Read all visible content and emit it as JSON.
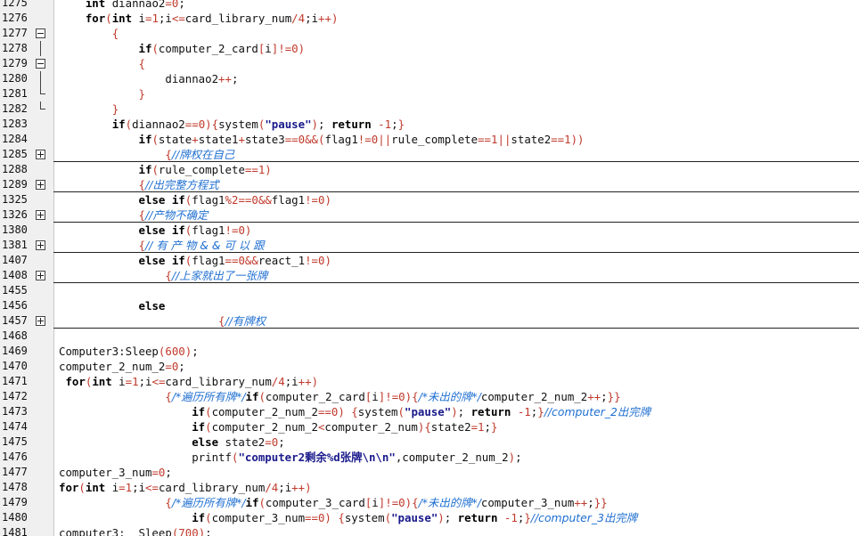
{
  "lines": [
    {
      "n": "1275",
      "fold": "none",
      "sep": false,
      "tokens": [
        [
          "pl",
          "    "
        ],
        [
          "kw",
          "int"
        ],
        [
          "pl",
          " diannao2"
        ],
        [
          "op",
          "="
        ],
        [
          "num",
          "0"
        ],
        [
          "pl",
          ";"
        ]
      ]
    },
    {
      "n": "1276",
      "fold": "none",
      "sep": false,
      "tokens": [
        [
          "pl",
          "    "
        ],
        [
          "kw",
          "for"
        ],
        [
          "br",
          "("
        ],
        [
          "kw",
          "int"
        ],
        [
          "pl",
          " i"
        ],
        [
          "op",
          "="
        ],
        [
          "num",
          "1"
        ],
        [
          "pl",
          ";i"
        ],
        [
          "op",
          "<="
        ],
        [
          "pl",
          "card_library_num"
        ],
        [
          "op",
          "/"
        ],
        [
          "num",
          "4"
        ],
        [
          "pl",
          ";i"
        ],
        [
          "op",
          "++"
        ],
        [
          "br",
          ")"
        ]
      ]
    },
    {
      "n": "1277",
      "fold": "minus",
      "sep": false,
      "tokens": [
        [
          "pl",
          "        "
        ],
        [
          "br",
          "{"
        ]
      ]
    },
    {
      "n": "1278",
      "fold": "line",
      "sep": false,
      "tokens": [
        [
          "pl",
          "            "
        ],
        [
          "kw",
          "if"
        ],
        [
          "br",
          "("
        ],
        [
          "pl",
          "computer_2_card"
        ],
        [
          "br",
          "["
        ],
        [
          "pl",
          "i"
        ],
        [
          "br",
          "]"
        ],
        [
          "op",
          "!="
        ],
        [
          "num",
          "0"
        ],
        [
          "br",
          ")"
        ]
      ]
    },
    {
      "n": "1279",
      "fold": "minus",
      "sep": false,
      "tokens": [
        [
          "pl",
          "            "
        ],
        [
          "br",
          "{"
        ]
      ]
    },
    {
      "n": "1280",
      "fold": "line",
      "sep": false,
      "tokens": [
        [
          "pl",
          "                diannao2"
        ],
        [
          "op",
          "++"
        ],
        [
          "pl",
          ";"
        ]
      ]
    },
    {
      "n": "1281",
      "fold": "end",
      "sep": false,
      "tokens": [
        [
          "pl",
          "            "
        ],
        [
          "br",
          "}"
        ]
      ]
    },
    {
      "n": "1282",
      "fold": "end",
      "sep": false,
      "tokens": [
        [
          "pl",
          "        "
        ],
        [
          "br",
          "}"
        ]
      ]
    },
    {
      "n": "1283",
      "fold": "none",
      "sep": false,
      "tokens": [
        [
          "pl",
          "        "
        ],
        [
          "kw",
          "if"
        ],
        [
          "br",
          "("
        ],
        [
          "pl",
          "diannao2"
        ],
        [
          "op",
          "=="
        ],
        [
          "num",
          "0"
        ],
        [
          "br",
          ")"
        ],
        [
          "br",
          "{"
        ],
        [
          "pl",
          "system"
        ],
        [
          "br",
          "("
        ],
        [
          "str",
          "\"pause\""
        ],
        [
          "br",
          ")"
        ],
        [
          "pl",
          "; "
        ],
        [
          "kw",
          "return"
        ],
        [
          "pl",
          " "
        ],
        [
          "op",
          "-"
        ],
        [
          "num",
          "1"
        ],
        [
          "pl",
          ";"
        ],
        [
          "br",
          "}"
        ]
      ]
    },
    {
      "n": "1284",
      "fold": "none",
      "sep": false,
      "tokens": [
        [
          "pl",
          "            "
        ],
        [
          "kw",
          "if"
        ],
        [
          "br",
          "("
        ],
        [
          "pl",
          "state"
        ],
        [
          "op",
          "+"
        ],
        [
          "pl",
          "state1"
        ],
        [
          "op",
          "+"
        ],
        [
          "pl",
          "state3"
        ],
        [
          "op",
          "=="
        ],
        [
          "num",
          "0"
        ],
        [
          "op",
          "&&"
        ],
        [
          "br",
          "("
        ],
        [
          "pl",
          "flag1"
        ],
        [
          "op",
          "!="
        ],
        [
          "num",
          "0"
        ],
        [
          "op",
          "||"
        ],
        [
          "pl",
          "rule_complete"
        ],
        [
          "op",
          "=="
        ],
        [
          "num",
          "1"
        ],
        [
          "op",
          "||"
        ],
        [
          "pl",
          "state2"
        ],
        [
          "op",
          "=="
        ],
        [
          "num",
          "1"
        ],
        [
          "br",
          "))"
        ]
      ]
    },
    {
      "n": "1285",
      "fold": "plus",
      "sep": true,
      "tokens": [
        [
          "pl",
          "                "
        ],
        [
          "br",
          "{"
        ],
        [
          "cm",
          "//牌权在自己"
        ]
      ]
    },
    {
      "n": "1288",
      "fold": "none",
      "sep": false,
      "tokens": [
        [
          "pl",
          "            "
        ],
        [
          "kw",
          "if"
        ],
        [
          "br",
          "("
        ],
        [
          "pl",
          "rule_complete"
        ],
        [
          "op",
          "=="
        ],
        [
          "num",
          "1"
        ],
        [
          "br",
          ")"
        ]
      ]
    },
    {
      "n": "1289",
      "fold": "plus",
      "sep": true,
      "tokens": [
        [
          "pl",
          "            "
        ],
        [
          "br",
          "{"
        ],
        [
          "cm",
          "//出完整方程式"
        ]
      ]
    },
    {
      "n": "1325",
      "fold": "none",
      "sep": false,
      "tokens": [
        [
          "pl",
          "            "
        ],
        [
          "kw",
          "else if"
        ],
        [
          "br",
          "("
        ],
        [
          "pl",
          "flag1"
        ],
        [
          "op",
          "%"
        ],
        [
          "num",
          "2"
        ],
        [
          "op",
          "=="
        ],
        [
          "num",
          "0"
        ],
        [
          "op",
          "&&"
        ],
        [
          "pl",
          "flag1"
        ],
        [
          "op",
          "!="
        ],
        [
          "num",
          "0"
        ],
        [
          "br",
          ")"
        ]
      ]
    },
    {
      "n": "1326",
      "fold": "plus",
      "sep": true,
      "tokens": [
        [
          "pl",
          "            "
        ],
        [
          "br",
          "{"
        ],
        [
          "cm",
          "//产物不确定"
        ]
      ]
    },
    {
      "n": "1380",
      "fold": "none",
      "sep": false,
      "tokens": [
        [
          "pl",
          "            "
        ],
        [
          "kw",
          "else if"
        ],
        [
          "br",
          "("
        ],
        [
          "pl",
          "flag1"
        ],
        [
          "op",
          "!="
        ],
        [
          "num",
          "0"
        ],
        [
          "br",
          ")"
        ]
      ]
    },
    {
      "n": "1381",
      "fold": "plus",
      "sep": true,
      "tokens": [
        [
          "pl",
          "            "
        ],
        [
          "br",
          "{"
        ],
        [
          "cm",
          "// 有 产 物 & & 可 以 跟"
        ]
      ]
    },
    {
      "n": "1407",
      "fold": "none",
      "sep": false,
      "tokens": [
        [
          "pl",
          "            "
        ],
        [
          "kw",
          "else if"
        ],
        [
          "br",
          "("
        ],
        [
          "pl",
          "flag1"
        ],
        [
          "op",
          "=="
        ],
        [
          "num",
          "0"
        ],
        [
          "op",
          "&&"
        ],
        [
          "pl",
          "react_1"
        ],
        [
          "op",
          "!="
        ],
        [
          "num",
          "0"
        ],
        [
          "br",
          ")"
        ]
      ]
    },
    {
      "n": "1408",
      "fold": "plus",
      "sep": true,
      "tokens": [
        [
          "pl",
          "                "
        ],
        [
          "br",
          "{"
        ],
        [
          "cm",
          "//上家就出了一张牌"
        ]
      ]
    },
    {
      "n": "1455",
      "fold": "none",
      "sep": false,
      "tokens": []
    },
    {
      "n": "1456",
      "fold": "none",
      "sep": false,
      "tokens": [
        [
          "pl",
          "            "
        ],
        [
          "kw",
          "else"
        ]
      ]
    },
    {
      "n": "1457",
      "fold": "plus",
      "sep": true,
      "tokens": [
        [
          "pl",
          "                        "
        ],
        [
          "br",
          "{"
        ],
        [
          "cm",
          "//有牌权"
        ]
      ]
    },
    {
      "n": "1468",
      "fold": "none",
      "sep": false,
      "tokens": []
    },
    {
      "n": "1469",
      "fold": "none",
      "sep": false,
      "tokens": [
        [
          "pl",
          "Computer3:Sleep"
        ],
        [
          "br",
          "("
        ],
        [
          "num",
          "600"
        ],
        [
          "br",
          ")"
        ],
        [
          "pl",
          ";"
        ]
      ]
    },
    {
      "n": "1470",
      "fold": "none",
      "sep": false,
      "tokens": [
        [
          "pl",
          "computer_2_num_2"
        ],
        [
          "op",
          "="
        ],
        [
          "num",
          "0"
        ],
        [
          "pl",
          ";"
        ]
      ]
    },
    {
      "n": "1471",
      "fold": "none",
      "sep": false,
      "tokens": [
        [
          "pl",
          " "
        ],
        [
          "kw",
          "for"
        ],
        [
          "br",
          "("
        ],
        [
          "kw",
          "int"
        ],
        [
          "pl",
          " i"
        ],
        [
          "op",
          "="
        ],
        [
          "num",
          "1"
        ],
        [
          "pl",
          ";i"
        ],
        [
          "op",
          "<="
        ],
        [
          "pl",
          "card_library_num"
        ],
        [
          "op",
          "/"
        ],
        [
          "num",
          "4"
        ],
        [
          "pl",
          ";i"
        ],
        [
          "op",
          "++"
        ],
        [
          "br",
          ")"
        ]
      ]
    },
    {
      "n": "1472",
      "fold": "none",
      "sep": false,
      "tokens": [
        [
          "pl",
          "                "
        ],
        [
          "br",
          "{"
        ],
        [
          "cm",
          "/*遍历所有牌*/"
        ],
        [
          "kw",
          "if"
        ],
        [
          "br",
          "("
        ],
        [
          "pl",
          "computer_2_card"
        ],
        [
          "br",
          "["
        ],
        [
          "pl",
          "i"
        ],
        [
          "br",
          "]"
        ],
        [
          "op",
          "!="
        ],
        [
          "num",
          "0"
        ],
        [
          "br",
          ")"
        ],
        [
          "br",
          "{"
        ],
        [
          "cm",
          "/*未出的牌*/"
        ],
        [
          "pl",
          "computer_2_num_2"
        ],
        [
          "op",
          "++"
        ],
        [
          "pl",
          ";"
        ],
        [
          "br",
          "}}"
        ]
      ]
    },
    {
      "n": "1473",
      "fold": "none",
      "sep": false,
      "tokens": [
        [
          "pl",
          "                    "
        ],
        [
          "kw",
          "if"
        ],
        [
          "br",
          "("
        ],
        [
          "pl",
          "computer_2_num_2"
        ],
        [
          "op",
          "=="
        ],
        [
          "num",
          "0"
        ],
        [
          "br",
          ")"
        ],
        [
          "pl",
          " "
        ],
        [
          "br",
          "{"
        ],
        [
          "pl",
          "system"
        ],
        [
          "br",
          "("
        ],
        [
          "str",
          "\"pause\""
        ],
        [
          "br",
          ")"
        ],
        [
          "pl",
          "; "
        ],
        [
          "kw",
          "return"
        ],
        [
          "pl",
          " "
        ],
        [
          "op",
          "-"
        ],
        [
          "num",
          "1"
        ],
        [
          "pl",
          ";"
        ],
        [
          "br",
          "}"
        ],
        [
          "cm",
          "//computer_2出完牌"
        ]
      ]
    },
    {
      "n": "1474",
      "fold": "none",
      "sep": false,
      "tokens": [
        [
          "pl",
          "                    "
        ],
        [
          "kw",
          "if"
        ],
        [
          "br",
          "("
        ],
        [
          "pl",
          "computer_2_num_2"
        ],
        [
          "op",
          "<"
        ],
        [
          "pl",
          "computer_2_num"
        ],
        [
          "br",
          ")"
        ],
        [
          "br",
          "{"
        ],
        [
          "pl",
          "state2"
        ],
        [
          "op",
          "="
        ],
        [
          "num",
          "1"
        ],
        [
          "pl",
          ";"
        ],
        [
          "br",
          "}"
        ]
      ]
    },
    {
      "n": "1475",
      "fold": "none",
      "sep": false,
      "tokens": [
        [
          "pl",
          "                    "
        ],
        [
          "kw",
          "else"
        ],
        [
          "pl",
          " state2"
        ],
        [
          "op",
          "="
        ],
        [
          "num",
          "0"
        ],
        [
          "pl",
          ";"
        ]
      ]
    },
    {
      "n": "1476",
      "fold": "none",
      "sep": false,
      "tokens": [
        [
          "pl",
          "                    printf"
        ],
        [
          "br",
          "("
        ],
        [
          "str",
          "\"computer2剩余%d张牌\\n\\n\""
        ],
        [
          "pl",
          ",computer_2_num_2"
        ],
        [
          "br",
          ")"
        ],
        [
          "pl",
          ";"
        ]
      ]
    },
    {
      "n": "1477",
      "fold": "none",
      "sep": false,
      "tokens": [
        [
          "pl",
          "computer_3_num"
        ],
        [
          "op",
          "="
        ],
        [
          "num",
          "0"
        ],
        [
          "pl",
          ";"
        ]
      ]
    },
    {
      "n": "1478",
      "fold": "none",
      "sep": false,
      "tokens": [
        [
          "kw",
          "for"
        ],
        [
          "br",
          "("
        ],
        [
          "kw",
          "int"
        ],
        [
          "pl",
          " i"
        ],
        [
          "op",
          "="
        ],
        [
          "num",
          "1"
        ],
        [
          "pl",
          ";i"
        ],
        [
          "op",
          "<="
        ],
        [
          "pl",
          "card_library_num"
        ],
        [
          "op",
          "/"
        ],
        [
          "num",
          "4"
        ],
        [
          "pl",
          ";i"
        ],
        [
          "op",
          "++"
        ],
        [
          "br",
          ")"
        ]
      ]
    },
    {
      "n": "1479",
      "fold": "none",
      "sep": false,
      "tokens": [
        [
          "pl",
          "                "
        ],
        [
          "br",
          "{"
        ],
        [
          "cm",
          "/*遍历所有牌*/"
        ],
        [
          "kw",
          "if"
        ],
        [
          "br",
          "("
        ],
        [
          "pl",
          "computer_3_card"
        ],
        [
          "br",
          "["
        ],
        [
          "pl",
          "i"
        ],
        [
          "br",
          "]"
        ],
        [
          "op",
          "!="
        ],
        [
          "num",
          "0"
        ],
        [
          "br",
          ")"
        ],
        [
          "br",
          "{"
        ],
        [
          "cm",
          "/*未出的牌*/"
        ],
        [
          "pl",
          "computer_3_num"
        ],
        [
          "op",
          "++"
        ],
        [
          "pl",
          ";"
        ],
        [
          "br",
          "}}"
        ]
      ]
    },
    {
      "n": "1480",
      "fold": "none",
      "sep": false,
      "tokens": [
        [
          "pl",
          "                    "
        ],
        [
          "kw",
          "if"
        ],
        [
          "br",
          "("
        ],
        [
          "pl",
          "computer_3_num"
        ],
        [
          "op",
          "=="
        ],
        [
          "num",
          "0"
        ],
        [
          "br",
          ")"
        ],
        [
          "pl",
          " "
        ],
        [
          "br",
          "{"
        ],
        [
          "pl",
          "system"
        ],
        [
          "br",
          "("
        ],
        [
          "str",
          "\"pause\""
        ],
        [
          "br",
          ")"
        ],
        [
          "pl",
          "; "
        ],
        [
          "kw",
          "return"
        ],
        [
          "pl",
          " "
        ],
        [
          "op",
          "-"
        ],
        [
          "num",
          "1"
        ],
        [
          "pl",
          ";"
        ],
        [
          "br",
          "}"
        ],
        [
          "cm",
          "//computer_3出完牌"
        ]
      ]
    },
    {
      "n": "1481",
      "fold": "none",
      "sep": false,
      "tokens": [
        [
          "pl",
          "computer3:  Sleep"
        ],
        [
          "br",
          "("
        ],
        [
          "num",
          "700"
        ],
        [
          "br",
          ")"
        ],
        [
          "pl",
          ";"
        ]
      ]
    }
  ]
}
